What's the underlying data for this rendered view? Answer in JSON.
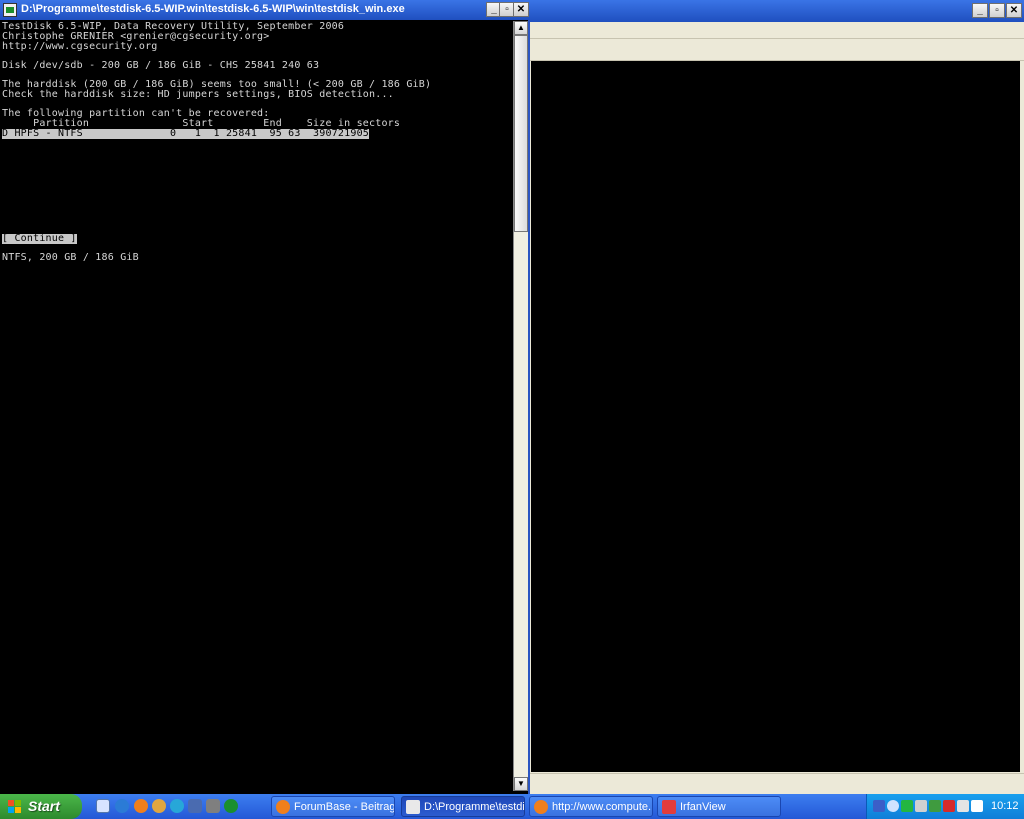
{
  "console_window": {
    "title": "D:\\Programme\\testdisk-6.5-WIP.win\\testdisk-6.5-WIP\\win\\testdisk_win.exe",
    "buttons": {
      "minimize": "_",
      "maximize": "▫",
      "close": "✕"
    },
    "lines": [
      "TestDisk 6.5-WIP, Data Recovery Utility, September 2006",
      "Christophe GRENIER <grenier@cgsecurity.org>",
      "http://www.cgsecurity.org",
      "Disk /dev/sdb - 200 GB / 186 GiB - CHS 25841 240 63",
      "The harddisk (200 GB / 186 GiB) seems too small! (< 200 GB / 186 GiB)",
      "Check the harddisk size: HD jumpers settings, BIOS detection...",
      "The following partition can't be recovered:",
      "     Partition               Start        End    Size in sectors",
      "D HPFS - NTFS              0   1  1 25841  95 63  390721905",
      "[ Continue ]",
      "NTFS, 200 GB / 186 GiB"
    ],
    "scrollbar": {
      "up": "▲",
      "down": "▼"
    }
  },
  "right_window": {
    "buttons": {
      "minimize": "_",
      "maximize": "▫",
      "close": "✕"
    }
  },
  "taskbar": {
    "start_label": "Start",
    "tasks": [
      {
        "label": "ForumBase - Beitrag ...",
        "icon": "firefox-icon"
      },
      {
        "label": "D:\\Programme\\testdi...",
        "icon": "console-icon"
      },
      {
        "label": "http://www.compute...",
        "icon": "firefox-icon"
      },
      {
        "label": "IrfanView",
        "icon": "irfanview-icon"
      }
    ],
    "clock": "10:12"
  }
}
